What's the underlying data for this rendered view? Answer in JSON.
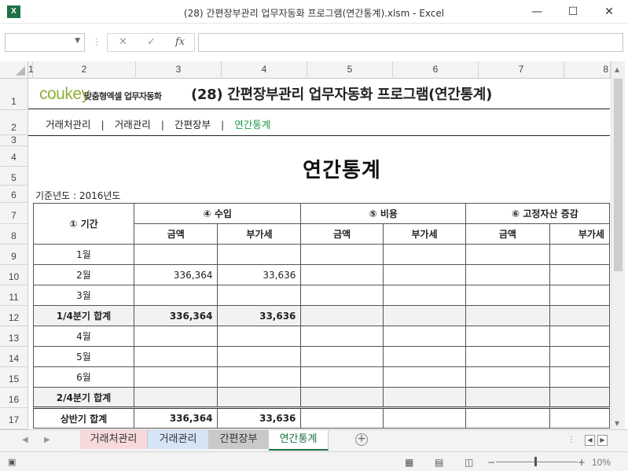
{
  "window": {
    "app_icon": "X",
    "title": "(28) 간편장부관리 업무자동화 프로그램(연간통계).xlsm - Excel",
    "minimize": "—",
    "maximize": "☐",
    "close": "✕"
  },
  "formula_bar": {
    "cancel": "✕",
    "enter": "✓",
    "fx": "fx",
    "value": ""
  },
  "columns": [
    "1",
    "2",
    "3",
    "4",
    "5",
    "6",
    "7",
    "8"
  ],
  "rows": [
    "1",
    "2",
    "3",
    "4",
    "5",
    "6",
    "7",
    "8",
    "9",
    "10",
    "11",
    "12",
    "13",
    "14",
    "15",
    "16",
    "17"
  ],
  "sheet": {
    "brand": "coukey",
    "brand_sub": "맞춤형엑셀 업무자동화",
    "title": "(28) 간편장부관리 업무자동화 프로그램(연간통계)",
    "nav": [
      "거래처관리",
      "거래관리",
      "간편장부",
      "연간통계"
    ],
    "nav_sep": "|",
    "report_title": "연간통계",
    "base_year": "기준년도 : 2016년도",
    "table": {
      "period_header": "① 기간",
      "income_header": "④ 수입",
      "expense_header": "⑤ 비용",
      "fixed_asset_header": "⑥ 고정자산 증감",
      "amount": "금액",
      "vat": "부가세",
      "rows": [
        {
          "label": "1월",
          "income_amount": "",
          "income_vat": ""
        },
        {
          "label": "2월",
          "income_amount": "336,364",
          "income_vat": "33,636"
        },
        {
          "label": "3월",
          "income_amount": "",
          "income_vat": ""
        },
        {
          "label": "1/4분기 합계",
          "income_amount": "336,364",
          "income_vat": "33,636"
        },
        {
          "label": "4월",
          "income_amount": "",
          "income_vat": ""
        },
        {
          "label": "5월",
          "income_amount": "",
          "income_vat": ""
        },
        {
          "label": "6월",
          "income_amount": "",
          "income_vat": ""
        },
        {
          "label": "2/4분기 합계",
          "income_amount": "",
          "income_vat": ""
        },
        {
          "label": "상반기 합계",
          "income_amount": "336,364",
          "income_vat": "33,636"
        }
      ]
    }
  },
  "tabs": [
    {
      "label": "거래처관리",
      "color": "#f7d9dc"
    },
    {
      "label": "거래관리",
      "color": "#d6e4f5"
    },
    {
      "label": "간편장부",
      "color": "#c9c9c9"
    },
    {
      "label": "연간통계",
      "color": "#ffffff"
    }
  ],
  "tab_add": "+",
  "status": {
    "zoom_minus": "−",
    "zoom_plus": "+",
    "zoom": "10%"
  }
}
